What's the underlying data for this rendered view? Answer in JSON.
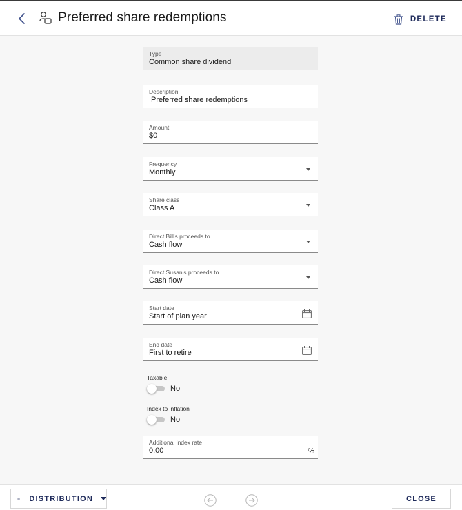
{
  "header": {
    "title": "Preferred share redemptions",
    "delete_label": "DELETE"
  },
  "fields": {
    "type": {
      "label": "Type",
      "value": "Common share dividend"
    },
    "description": {
      "label": "Description",
      "value": "Preferred share redemptions"
    },
    "amount": {
      "label": "Amount",
      "value": "$0"
    },
    "frequency": {
      "label": "Frequency",
      "value": "Monthly"
    },
    "share_class": {
      "label": "Share class",
      "value": "Class A"
    },
    "direct_bill": {
      "label": "Direct Bill's proceeds to",
      "value": "Cash flow"
    },
    "direct_susan": {
      "label": "Direct Susan's proceeds to",
      "value": "Cash flow"
    },
    "start_date": {
      "label": "Start date",
      "value": "Start of plan year"
    },
    "end_date": {
      "label": "End date",
      "value": "First to retire"
    },
    "additional_index_rate": {
      "label": "Additional index rate",
      "value": "0.00",
      "unit": "%"
    }
  },
  "switches": {
    "taxable": {
      "label": "Taxable",
      "value": "No",
      "on": false
    },
    "index_to_inflation": {
      "label": "Index to inflation",
      "value": "No",
      "on": false
    }
  },
  "footer": {
    "distribution_label": "DISTRIBUTION",
    "close_label": "CLOSE"
  },
  "colors": {
    "accent": "#1e2a5a",
    "icon": "#3d4f8a",
    "readonly_bg": "#ececec",
    "page_bg": "#f7f7f7"
  },
  "icons": {
    "back": "chevron-left-icon",
    "title": "person-share-icon",
    "delete": "trash-icon",
    "calendar": "calendar-icon",
    "add": "plus-icon",
    "previous": "arrow-left-circle-icon",
    "next": "arrow-right-circle-icon"
  }
}
